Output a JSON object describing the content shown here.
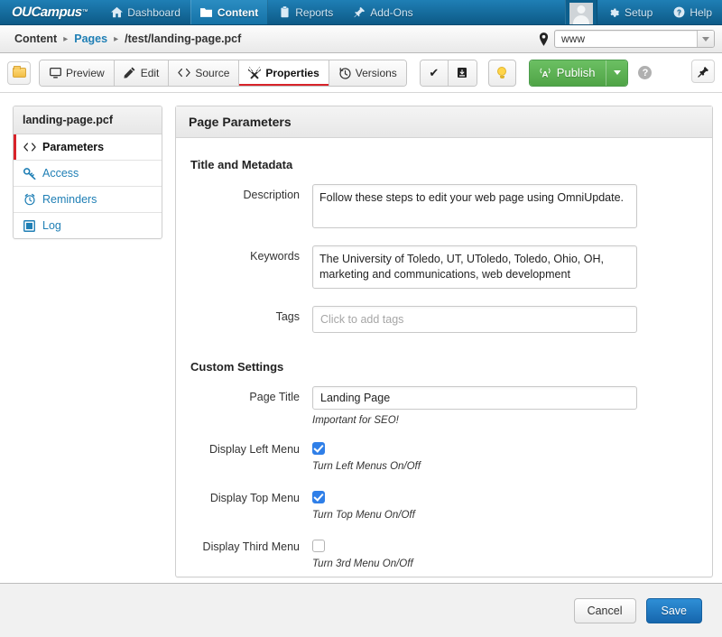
{
  "topnav": {
    "brand": "OUCampus",
    "brand_tm": "™",
    "items": [
      {
        "label": "Dashboard",
        "icon": "home-icon",
        "active": false
      },
      {
        "label": "Content",
        "icon": "folder-icon",
        "active": true
      },
      {
        "label": "Reports",
        "icon": "clipboard-icon",
        "active": false
      },
      {
        "label": "Add-Ons",
        "icon": "pin-icon",
        "active": false
      }
    ],
    "right_items": [
      {
        "label": "Setup",
        "icon": "gear-icon"
      },
      {
        "label": "Help",
        "icon": "question-circle-icon"
      }
    ],
    "avatar": "user-avatar"
  },
  "breadcrumb": {
    "root": "Content",
    "section": "Pages",
    "path": "/test/landing-page.pcf",
    "separator": "▸",
    "site_selector": {
      "icon": "location-pin-icon",
      "value": "www"
    }
  },
  "toolbar": {
    "folder_button": "folder-button",
    "tabs": [
      {
        "label": "Preview",
        "icon": "monitor-icon",
        "active": false
      },
      {
        "label": "Edit",
        "icon": "pencil-icon",
        "active": false
      },
      {
        "label": "Source",
        "icon": "code-icon",
        "active": false
      },
      {
        "label": "Properties",
        "icon": "wrench-screwdriver-icon",
        "active": true
      },
      {
        "label": "Versions",
        "icon": "clock-revert-icon",
        "active": false
      }
    ],
    "check_button": "✔",
    "archive_button": "archive-box-icon",
    "lightbulb_button": "lightbulb-icon",
    "publish_label": "Publish",
    "publish_icon": "broadcast-icon",
    "help_label": "?",
    "plugin_button": "plug-icon"
  },
  "sidebar": {
    "header": "landing-page.pcf",
    "items": [
      {
        "label": "Parameters",
        "icon": "code-icon",
        "active": true
      },
      {
        "label": "Access",
        "icon": "key-icon",
        "active": false
      },
      {
        "label": "Reminders",
        "icon": "alarm-clock-icon",
        "active": false
      },
      {
        "label": "Log",
        "icon": "log-book-icon",
        "active": false
      }
    ]
  },
  "main": {
    "panel_title": "Page Parameters",
    "sections": [
      {
        "title": "Title and Metadata"
      },
      {
        "title": "Custom Settings"
      }
    ],
    "fields": {
      "description": {
        "label": "Description",
        "value": "Follow these steps to edit your web page using OmniUpdate."
      },
      "keywords": {
        "label": "Keywords",
        "value": "The University of Toledo, UT, UToledo, Toledo, Ohio, OH, marketing and communications, web development"
      },
      "tags": {
        "label": "Tags",
        "placeholder": "Click to add tags",
        "value": ""
      },
      "page_title": {
        "label": "Page Title",
        "value": "Landing Page",
        "hint": "Important for SEO!"
      },
      "display_left_menu": {
        "label": "Display Left Menu",
        "checked": true,
        "hint": "Turn Left Menus On/Off"
      },
      "display_top_menu": {
        "label": "Display Top Menu",
        "checked": true,
        "hint": "Turn Top Menu On/Off"
      },
      "display_third_menu": {
        "label": "Display Third Menu",
        "checked": false,
        "hint": "Turn 3rd Menu On/Off"
      }
    }
  },
  "footer": {
    "cancel_label": "Cancel",
    "save_label": "Save"
  },
  "colors": {
    "nav_blue": "#1f7fb5",
    "nav_blue_dark": "#0d5a87",
    "link_blue": "#1f7fb5",
    "accent_red": "#d8232a",
    "publish_green": "#4fa446",
    "save_blue": "#1666ad",
    "checkbox_blue": "#2f7fe8"
  }
}
